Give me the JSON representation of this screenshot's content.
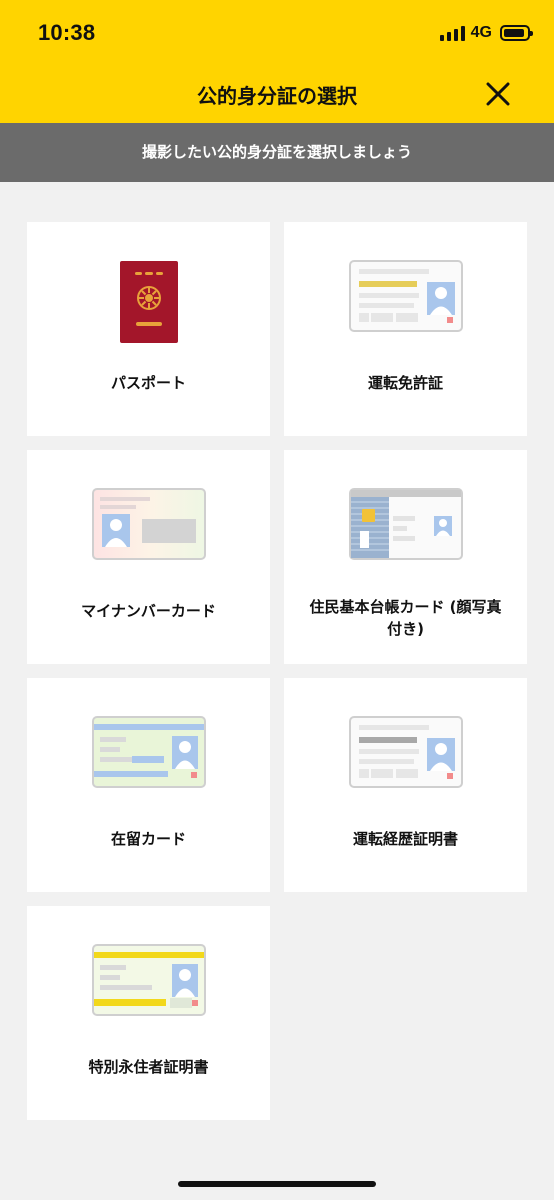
{
  "status": {
    "time": "10:38",
    "network": "4G"
  },
  "header": {
    "title": "公的身分証の選択",
    "subtitle": "撮影したい公的身分証を選択しましょう"
  },
  "options": [
    {
      "label": "パスポート",
      "icon": "passport-icon"
    },
    {
      "label": "運転免許証",
      "icon": "drivers-license-icon"
    },
    {
      "label": "マイナンバーカード",
      "icon": "my-number-card-icon"
    },
    {
      "label": "住民基本台帳カード (顔写真付き)",
      "icon": "resident-card-icon"
    },
    {
      "label": "在留カード",
      "icon": "residence-card-icon"
    },
    {
      "label": "運転経歴証明書",
      "icon": "driving-history-icon"
    },
    {
      "label": "特別永住者証明書",
      "icon": "special-permanent-resident-icon"
    }
  ]
}
